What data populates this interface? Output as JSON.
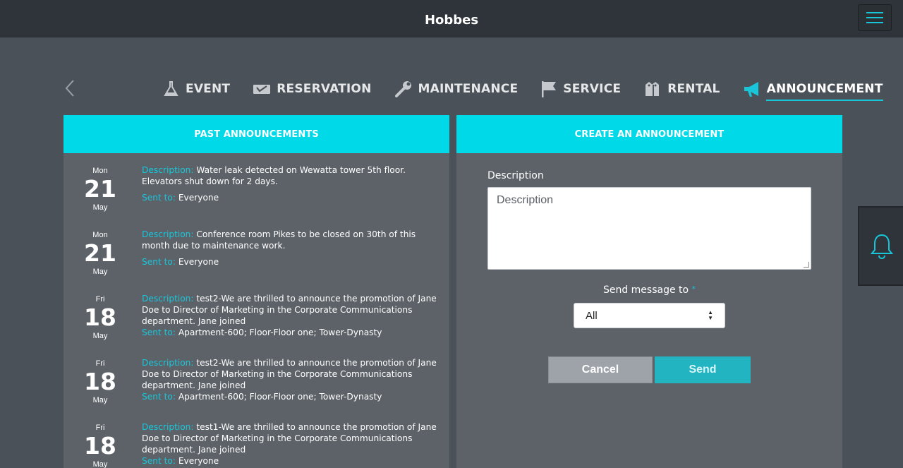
{
  "app": {
    "title": "Hobbes"
  },
  "nav": {
    "tabs": [
      {
        "label": "EVENT",
        "icon": "flask-icon"
      },
      {
        "label": "RESERVATION",
        "icon": "ticket-icon"
      },
      {
        "label": "MAINTENANCE",
        "icon": "wrench-icon"
      },
      {
        "label": "SERVICE",
        "icon": "flag-icon"
      },
      {
        "label": "RENTAL",
        "icon": "tags-icon"
      },
      {
        "label": "ANNOUNCEMENT",
        "icon": "megaphone-icon",
        "active": true
      }
    ]
  },
  "past": {
    "header": "PAST ANNOUNCEMENTS",
    "desc_label": "Description:",
    "sent_label": "Sent to:",
    "items": [
      {
        "dow": "Mon",
        "day": "21",
        "month": "May",
        "description": "Water leak detected on Wewatta tower 5th floor. Elevators shut down for 2 days.",
        "sent_to": "Everyone"
      },
      {
        "dow": "Mon",
        "day": "21",
        "month": "May",
        "description": "Conference room Pikes to be closed on 30th of this month due to maintenance work.",
        "sent_to": "Everyone"
      },
      {
        "dow": "Fri",
        "day": "18",
        "month": "May",
        "description": "test2-We are thrilled to announce the promotion of Jane Doe to Director of Marketing in the Corporate Communications department. Jane joined",
        "sent_to": "Apartment-600; Floor-Floor one; Tower-Dynasty"
      },
      {
        "dow": "Fri",
        "day": "18",
        "month": "May",
        "description": "test2-We are thrilled to announce the promotion of Jane Doe to Director of Marketing in the Corporate Communications department. Jane joined",
        "sent_to": "Apartment-600; Floor-Floor one; Tower-Dynasty"
      },
      {
        "dow": "Fri",
        "day": "18",
        "month": "May",
        "description": "test1-We are thrilled to announce the promotion of Jane Doe to Director of Marketing in the Corporate Communications department. Jane joined",
        "sent_to": "Everyone"
      }
    ]
  },
  "create": {
    "header": "CREATE AN ANNOUNCEMENT",
    "description_label": "Description",
    "description_placeholder": "Description",
    "send_to_label": "Send message to",
    "required_mark": "*",
    "send_to_value": "All",
    "cancel_label": "Cancel",
    "send_label": "Send"
  },
  "colors": {
    "accent": "#00d9e8",
    "topbar": "#2f343a",
    "background": "#4b5158",
    "panel": "#5d6269"
  }
}
